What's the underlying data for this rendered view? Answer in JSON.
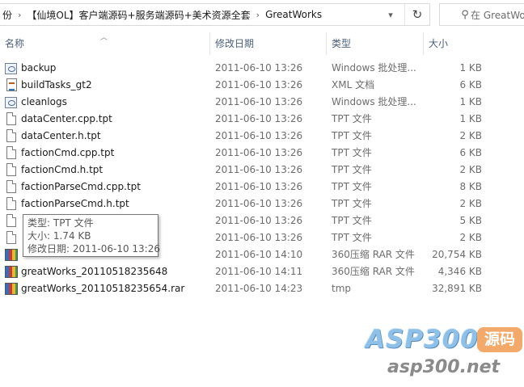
{
  "address": {
    "crumbs": [
      "份",
      "【仙境OL】客户端源码+服务端源码+美术资源全套",
      "GreatWorks"
    ],
    "dropdown_icon": "chevron-down-icon",
    "refresh_icon": "refresh-icon",
    "search_placeholder": "在 GreatWo"
  },
  "columns": {
    "name": "名称",
    "date": "修改日期",
    "type": "类型",
    "size": "大小"
  },
  "files": [
    {
      "name": "backup",
      "date": "2011-06-10 13:26",
      "type": "Windows 批处理...",
      "size": "1 KB",
      "icon": "bat"
    },
    {
      "name": "buildTasks_gt2",
      "date": "2011-06-10 13:26",
      "type": "XML 文档",
      "size": "6 KB",
      "icon": "xml"
    },
    {
      "name": "cleanlogs",
      "date": "2011-06-10 13:26",
      "type": "Windows 批处理...",
      "size": "1 KB",
      "icon": "bat"
    },
    {
      "name": "dataCenter.cpp.tpt",
      "date": "2011-06-10 13:26",
      "type": "TPT 文件",
      "size": "1 KB",
      "icon": "doc"
    },
    {
      "name": "dataCenter.h.tpt",
      "date": "2011-06-10 13:26",
      "type": "TPT 文件",
      "size": "2 KB",
      "icon": "doc"
    },
    {
      "name": "factionCmd.cpp.tpt",
      "date": "2011-06-10 13:26",
      "type": "TPT 文件",
      "size": "6 KB",
      "icon": "doc"
    },
    {
      "name": "factionCmd.h.tpt",
      "date": "2011-06-10 13:26",
      "type": "TPT 文件",
      "size": "2 KB",
      "icon": "doc"
    },
    {
      "name": "factionParseCmd.cpp.tpt",
      "date": "2011-06-10 13:26",
      "type": "TPT 文件",
      "size": "8 KB",
      "icon": "doc"
    },
    {
      "name": "factionParseCmd.h.tpt",
      "date": "2011-06-10 13:26",
      "type": "TPT 文件",
      "size": "2 KB",
      "icon": "doc"
    },
    {
      "name": "",
      "date": "2011-06-10 13:26",
      "type": "TPT 文件",
      "size": "5 KB",
      "icon": "doc"
    },
    {
      "name": "",
      "date": "2011-06-10 13:26",
      "type": "TPT 文件",
      "size": "2 KB",
      "icon": "doc"
    },
    {
      "name": "",
      "date": "2011-06-10 14:10",
      "type": "360压缩 RAR 文件",
      "size": "20,754 KB",
      "icon": "rar"
    },
    {
      "name": "greatWorks_20110518235648",
      "date": "2011-06-10 14:11",
      "type": "360压缩 RAR 文件",
      "size": "4,346 KB",
      "icon": "rar"
    },
    {
      "name": "greatWorks_20110518235654.rar",
      "date": "2011-06-10 14:23",
      "type": "tmp",
      "size": "32,891 KB",
      "icon": "rar"
    }
  ],
  "tooltip": {
    "type_line": "类型: TPT 文件",
    "size_line": "大小: 1.74 KB",
    "date_line": "修改日期: 2011-06-10 13:26"
  },
  "watermark": {
    "brand": "ASP300",
    "badge": "源码",
    "url": "asp300.net"
  }
}
